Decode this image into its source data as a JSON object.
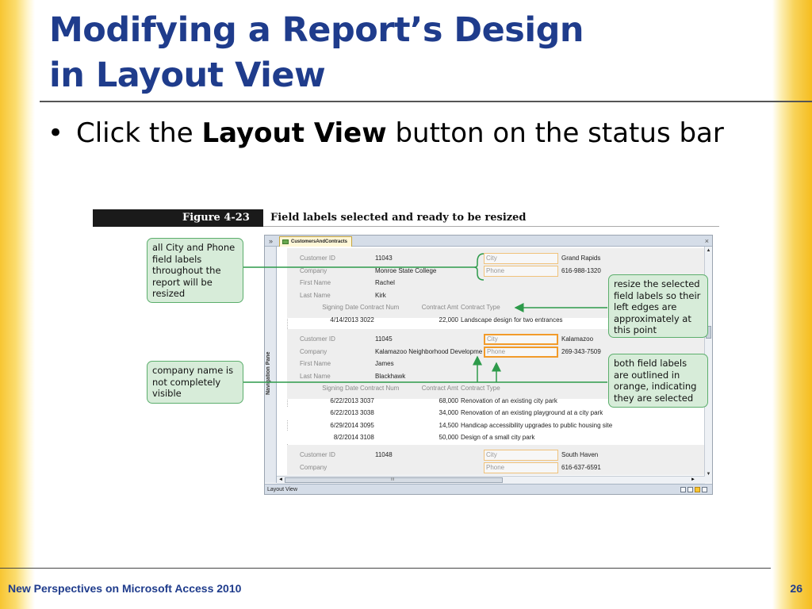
{
  "slide": {
    "title_line1": "Modifying a Report’s Design",
    "title_line2": "in Layout View",
    "bullet_prefix": "Click the ",
    "bullet_bold": "Layout View",
    "bullet_suffix": " button on the status bar",
    "bullet_glyph": "•",
    "footer": "New Perspectives on Microsoft Access 2010",
    "page_number": "26",
    "colors": {
      "title": "#1f3c8c",
      "accent_gold": "#f7c531",
      "callout_fill": "#d7ecd9",
      "callout_border": "#5cae6c",
      "selection_orange": "#f29b2a"
    }
  },
  "figure": {
    "number": "Figure 4-23",
    "caption": "Field labels selected and ready to be resized"
  },
  "window": {
    "nav_toggle": "»",
    "tab_label": "CustomersAndContracts",
    "close_glyph": "×",
    "nav_pane_label": "Navigation Pane",
    "status_label": "Layout View",
    "scroll_up": "▲",
    "scroll_down": "▼",
    "scroll_left": "◄",
    "scroll_right": "►",
    "hscroll_marker": "III"
  },
  "report": {
    "labels": {
      "customer_id": "Customer ID",
      "company": "Company",
      "first_name": "First Name",
      "last_name": "Last Name",
      "city": "City",
      "phone": "Phone"
    },
    "contract_headers": [
      "Signing Date",
      "Contract Num",
      "Contract Amt",
      "Contract Type"
    ],
    "records": [
      {
        "customer_id": "11043",
        "company": "Monroe State College",
        "first_name": "Rachel",
        "last_name": "Kirk",
        "city": "Grand Rapids",
        "phone": "616-988-1320",
        "contracts": [
          {
            "date": "4/14/2013",
            "num": "3022",
            "amt": "22,000",
            "type": "Landscape design for two entrances"
          }
        ]
      },
      {
        "customer_id": "11045",
        "company": "Kalamazoo Neighborhood Developme",
        "first_name": "James",
        "last_name": "Blackhawk",
        "city": "Kalamazoo",
        "phone": "269-343-7509",
        "contracts": [
          {
            "date": "6/22/2013",
            "num": "3037",
            "amt": "68,000",
            "type": "Renovation of an existing city park"
          },
          {
            "date": "6/22/2013",
            "num": "3038",
            "amt": "34,000",
            "type": "Renovation of an existing playground at a city park"
          },
          {
            "date": "6/29/2014",
            "num": "3095",
            "amt": "14,500",
            "type": "Handicap accessibility upgrades to public housing site"
          },
          {
            "date": "8/2/2014",
            "num": "3108",
            "amt": "50,000",
            "type": "Design of a small city park"
          }
        ]
      },
      {
        "customer_id": "11048",
        "company": "",
        "first_name": "",
        "last_name": "",
        "city": "South Haven",
        "phone": "616-637-6591",
        "contracts": []
      }
    ]
  },
  "callouts": {
    "left_top": "all City and Phone field labels throughout the report will be resized",
    "left_bottom": "company name is not completely visible",
    "right_top": "resize the selected field labels so their left edges are approximately at this point",
    "right_bottom": "both field labels are outlined in orange, indicating they are selected"
  }
}
